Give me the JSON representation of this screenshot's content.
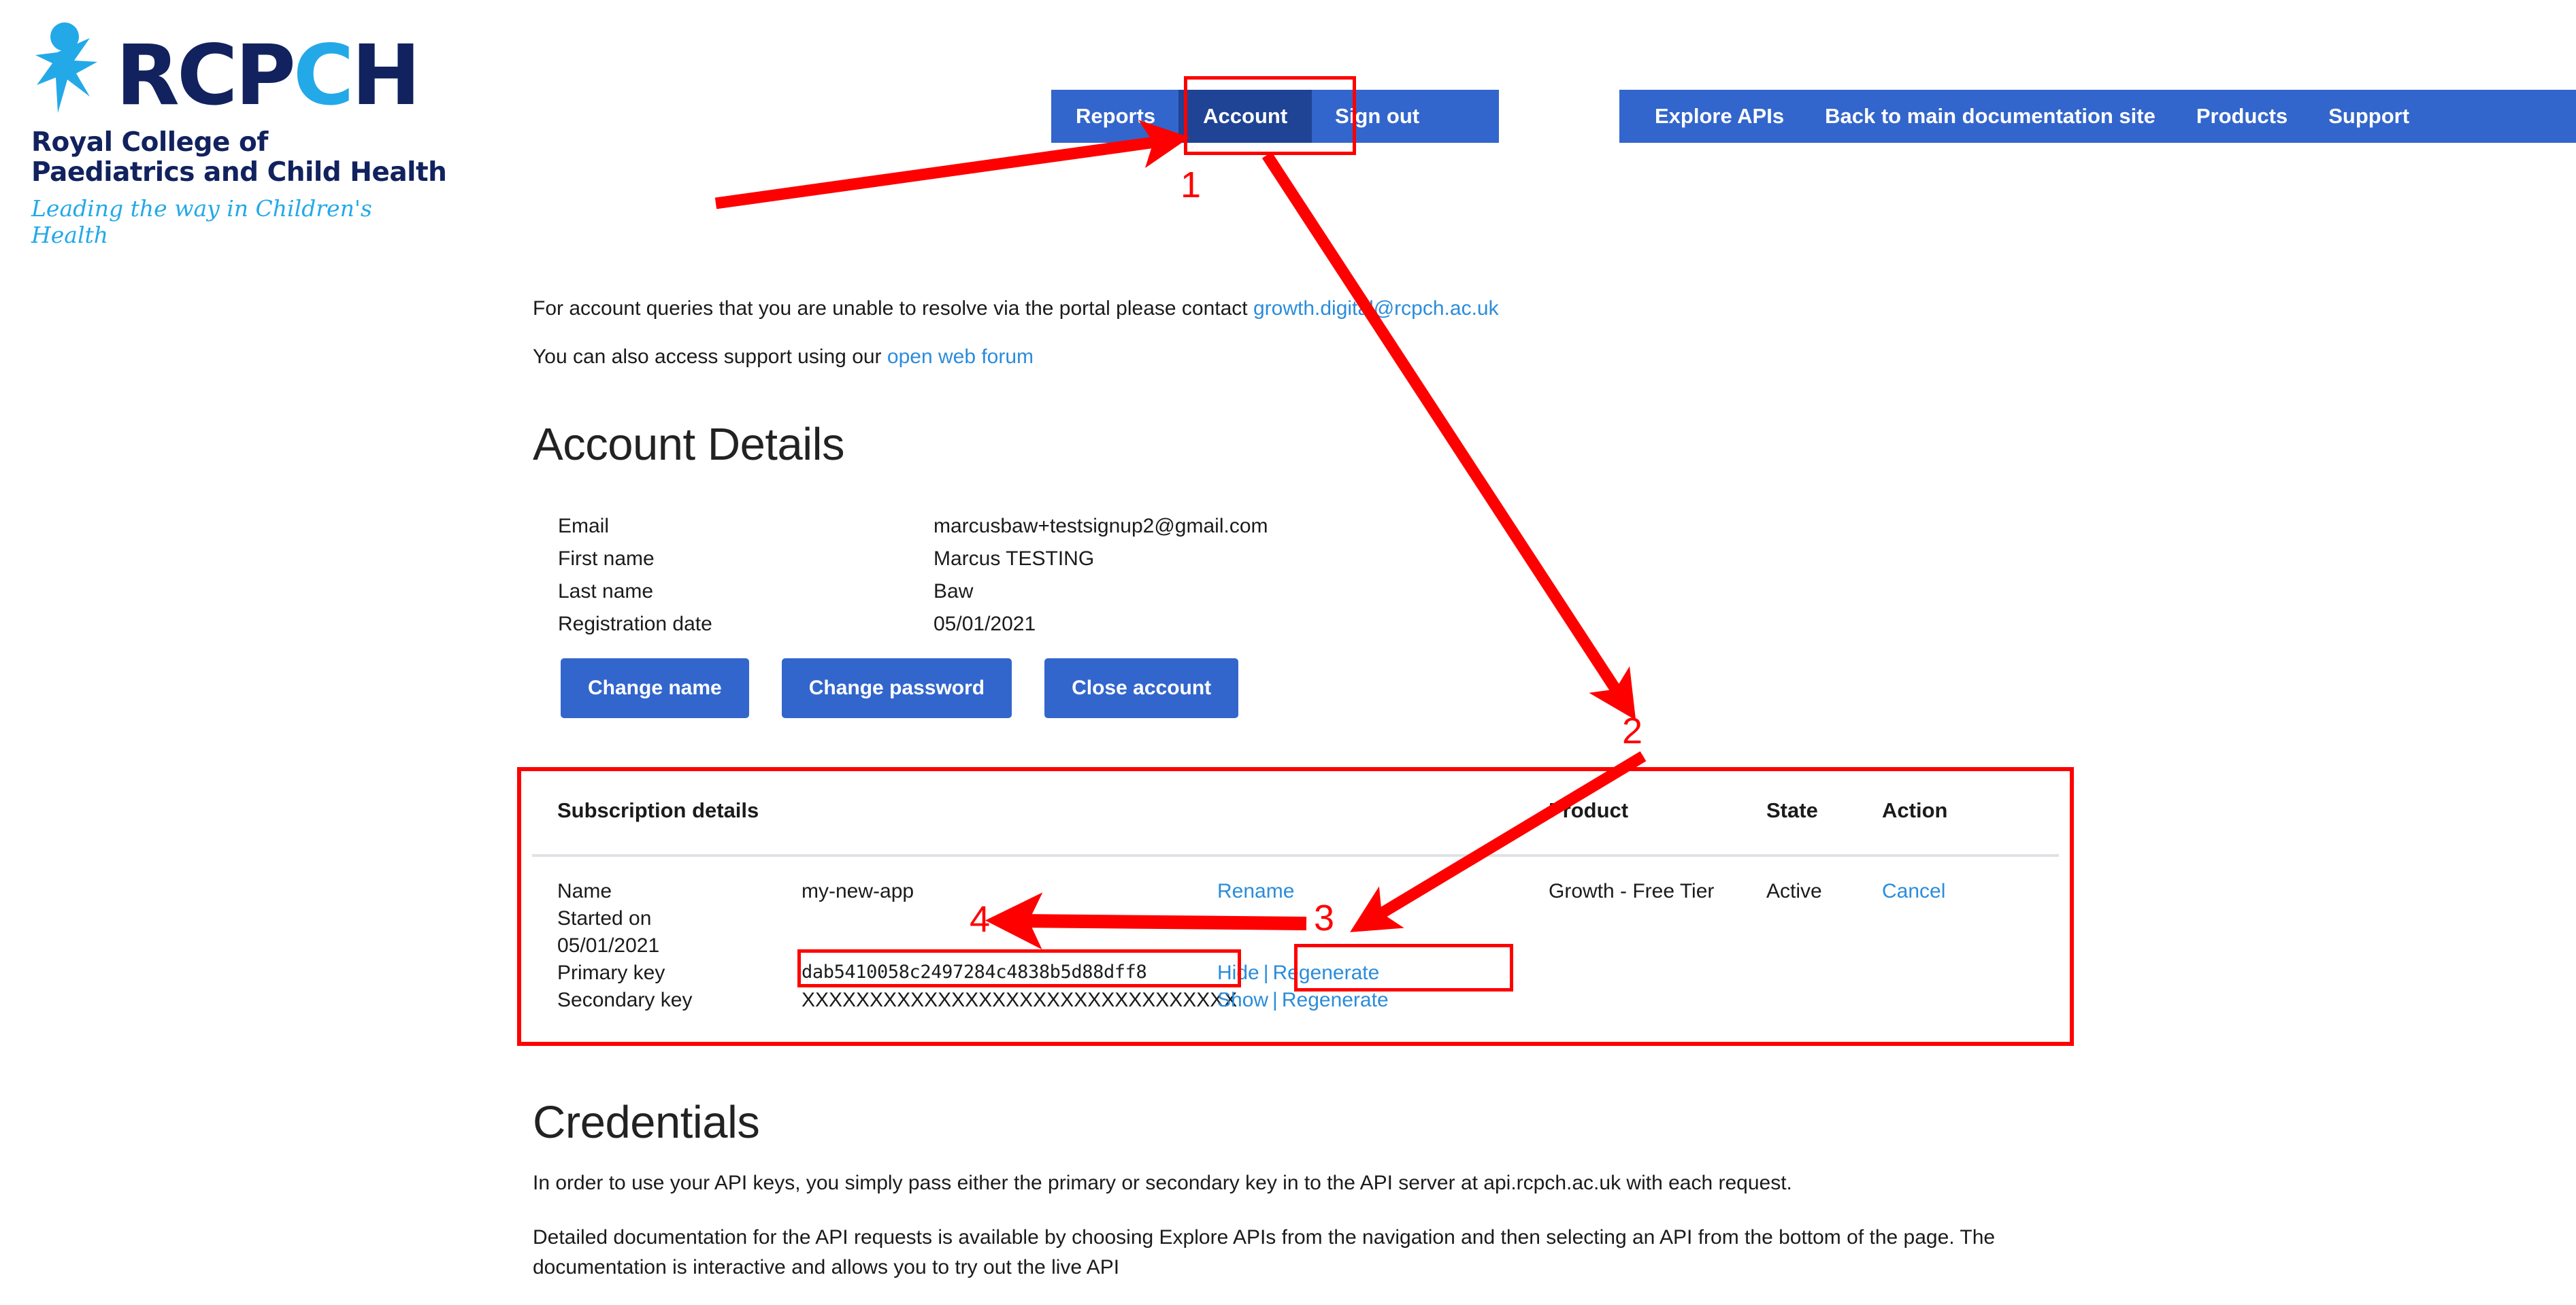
{
  "logo": {
    "wordmark_dark_1": "R",
    "wordmark_dark_2": "CP",
    "wordmark_cyan": "C",
    "wordmark_dark_3": "H",
    "subline_1": "Royal College of",
    "subline_2": "Paediatrics and Child Health",
    "tagline": "Leading the way in Children's Health",
    "brand_navy": "#11225e",
    "brand_cyan": "#23a9e8"
  },
  "nav_primary": {
    "background": "#3366cc",
    "active_background": "#1f4495",
    "items": [
      {
        "label": "Reports",
        "active": false
      },
      {
        "label": "Account",
        "active": true
      },
      {
        "label": "Sign out",
        "active": false
      }
    ]
  },
  "nav_secondary": {
    "background": "#3366cc",
    "items": [
      {
        "label": "Explore APIs"
      },
      {
        "label": "Back to main documentation site"
      },
      {
        "label": "Products"
      },
      {
        "label": "Support"
      }
    ]
  },
  "intro": {
    "line1_text": "For account queries that you are unable to resolve via the portal please contact ",
    "line1_link": "growth.digital@rcpch.ac.uk",
    "line2_text": "You can also access support using our ",
    "line2_link": "open web forum"
  },
  "account_details": {
    "title": "Account Details",
    "fields": [
      {
        "label": "Email",
        "value": "marcusbaw+testsignup2@gmail.com"
      },
      {
        "label": "First name",
        "value": "Marcus TESTING"
      },
      {
        "label": "Last name",
        "value": "Baw"
      },
      {
        "label": "Registration date",
        "value": "05/01/2021"
      }
    ],
    "buttons": [
      {
        "label": "Change name"
      },
      {
        "label": "Change password"
      },
      {
        "label": "Close account"
      }
    ]
  },
  "subscription": {
    "headers": {
      "details": "Subscription details",
      "product": "Product",
      "state": "State",
      "action": "Action"
    },
    "rows": [
      {
        "label": "Name",
        "value": "my-new-app",
        "action": "Rename",
        "product": "Growth - Free Tier",
        "state": "Active",
        "cancel": "Cancel"
      },
      {
        "label": "Started on",
        "value": "",
        "action": ""
      },
      {
        "label": "05/01/2021",
        "value": "",
        "action": ""
      },
      {
        "label": "Primary key",
        "value": "dab5410058c2497284c4838b5d88dff8",
        "action_hide": "Hide",
        "action_sep": "|",
        "action_regen": "Regenerate"
      },
      {
        "label": "Secondary key",
        "value": "XXXXXXXXXXXXXXXXXXXXXXXXXXXXXXXX",
        "action_show": "Show",
        "action_sep": "|",
        "action_regen": "Regenerate"
      }
    ]
  },
  "credentials": {
    "title": "Credentials",
    "para1": "In order to use your API keys, you simply pass either the primary or secondary key in to the API server at api.rcpch.ac.uk with each request.",
    "para2": "Detailed documentation for the API requests is available by choosing Explore APIs from the navigation and then selecting an API from the bottom of the page. The documentation is interactive and allows you to try out the live API"
  },
  "annotations": {
    "color": "#ff0000",
    "markers": [
      {
        "id": "1",
        "label": "1"
      },
      {
        "id": "2",
        "label": "2"
      },
      {
        "id": "3",
        "label": "3"
      },
      {
        "id": "4",
        "label": "4"
      }
    ]
  }
}
